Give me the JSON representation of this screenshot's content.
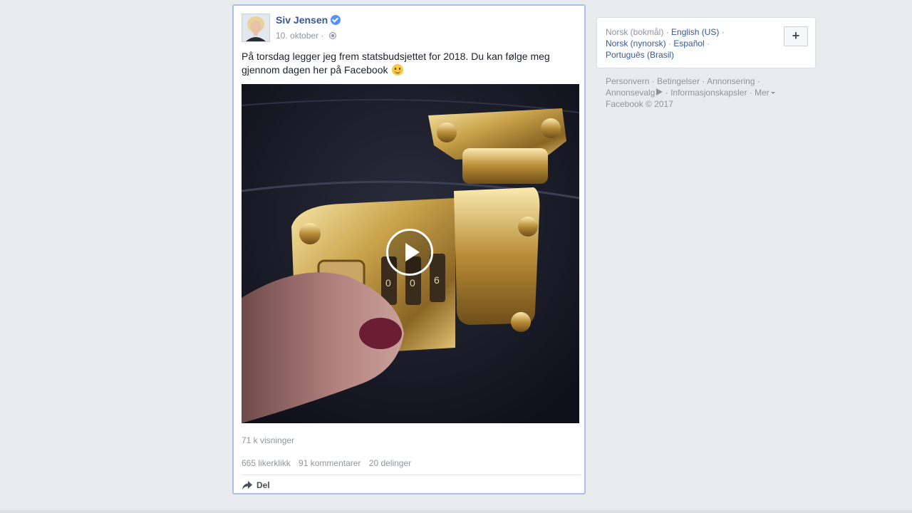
{
  "post": {
    "author": "Siv Jensen",
    "date": "10. oktober",
    "separator": " · ",
    "text": "På torsdag legger jeg frem statsbudsjettet for 2018. Du kan følge meg gjennom dagen her på Facebook",
    "views": "71 k visninger",
    "likes": "665 likerklikk",
    "comments": "91 kommentarer",
    "shares": "20 delinger",
    "share_label": "Del"
  },
  "languages": {
    "current": "Norsk (bokmål)",
    "english": "English (US)",
    "nynorsk": "Norsk (nynorsk)",
    "spanish": "Español",
    "portuguese": "Português (Brasil)",
    "add_label": "+"
  },
  "footer": {
    "privacy": "Personvern",
    "terms": "Betingelser",
    "advertising": "Annonsering",
    "adchoices": "Annonsevalg",
    "cookies": "Informasjonskapsler",
    "more": "Mer",
    "copyright": "Facebook © 2017"
  },
  "icons": {
    "verified": "verified-badge-icon",
    "privacy": "globe-icon",
    "play": "play-icon",
    "share": "share-arrow-icon",
    "emoji": "smiley-emoji-icon",
    "adchoices": "adchoices-icon"
  },
  "colors": {
    "link": "#365899",
    "muted": "#90949c",
    "background": "#e9ebee",
    "focus_border": "#a8c0f0"
  }
}
